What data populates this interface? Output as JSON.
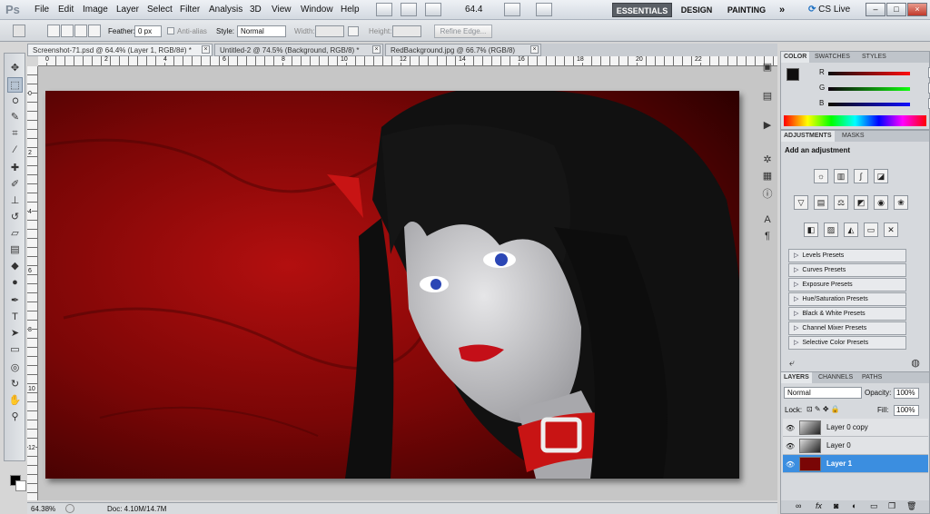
{
  "app": {
    "logo": "Ps",
    "menu": [
      "File",
      "Edit",
      "Image",
      "Layer",
      "Select",
      "Filter",
      "Analysis",
      "3D",
      "View",
      "Window",
      "Help"
    ],
    "menubar_icons": [
      "br-icon",
      "mb-icon",
      "view-extras-icon"
    ],
    "zoom_value": "64.4",
    "workspaces": {
      "essentials": "ESSENTIALS",
      "design": "DESIGN",
      "painting": "PAINTING",
      "more": "»"
    },
    "cs_live": "CS Live"
  },
  "options_bar": {
    "feather_label": "Feather:",
    "feather_value": "0 px",
    "antialias_label": "Anti-alias",
    "style_label": "Style:",
    "style_value": "Normal",
    "width_label": "Width:",
    "height_label": "Height:",
    "refine_edge": "Refine Edge..."
  },
  "documents": {
    "tabs": [
      {
        "label": "Screenshot-71.psd @ 64.4% (Layer 1, RGB/8#) *",
        "active": true
      },
      {
        "label": "Untitled-2 @ 74.5% (Background, RGB/8) *",
        "active": false
      },
      {
        "label": "RedBackground.jpg @ 66.7% (RGB/8)",
        "active": false
      }
    ],
    "close": "×"
  },
  "rulers": {
    "h_ticks": [
      "0",
      "2",
      "4",
      "6",
      "8",
      "10",
      "12",
      "14",
      "16",
      "18",
      "20",
      "22"
    ],
    "v_ticks": [
      "0",
      "2",
      "4",
      "6",
      "8",
      "10",
      "12"
    ]
  },
  "status_bar": {
    "zoom": "64.38%",
    "doc": "Doc: 4.10M/14.7M"
  },
  "color_panel": {
    "tabs": [
      "COLOR",
      "SWATCHES",
      "STYLES"
    ],
    "r_label": "R",
    "g_label": "G",
    "b_label": "B",
    "r": "15",
    "g": "14",
    "b": "14",
    "foreground": "#0f0e0e",
    "background": "#ffffff"
  },
  "adjustments_panel": {
    "tabs": [
      "ADJUSTMENTS",
      "MASKS"
    ],
    "title": "Add an adjustment",
    "presets": [
      "Levels Presets",
      "Curves Presets",
      "Exposure Presets",
      "Hue/Saturation Presets",
      "Black & White Presets",
      "Channel Mixer Presets",
      "Selective Color Presets"
    ]
  },
  "layers_panel": {
    "tabs": [
      "LAYERS",
      "CHANNELS",
      "PATHS"
    ],
    "blend_mode": "Normal",
    "opacity_label": "Opacity:",
    "opacity": "100%",
    "lock_label": "Lock:",
    "fill_label": "Fill:",
    "fill": "100%",
    "layers": [
      {
        "name": "Layer 0 copy",
        "selected": false
      },
      {
        "name": "Layer 0",
        "selected": false
      },
      {
        "name": "Layer 1",
        "selected": true
      }
    ]
  },
  "colors": {
    "accent_selected": "#3b8ee0",
    "canvas_red": "#8b0a0a"
  }
}
